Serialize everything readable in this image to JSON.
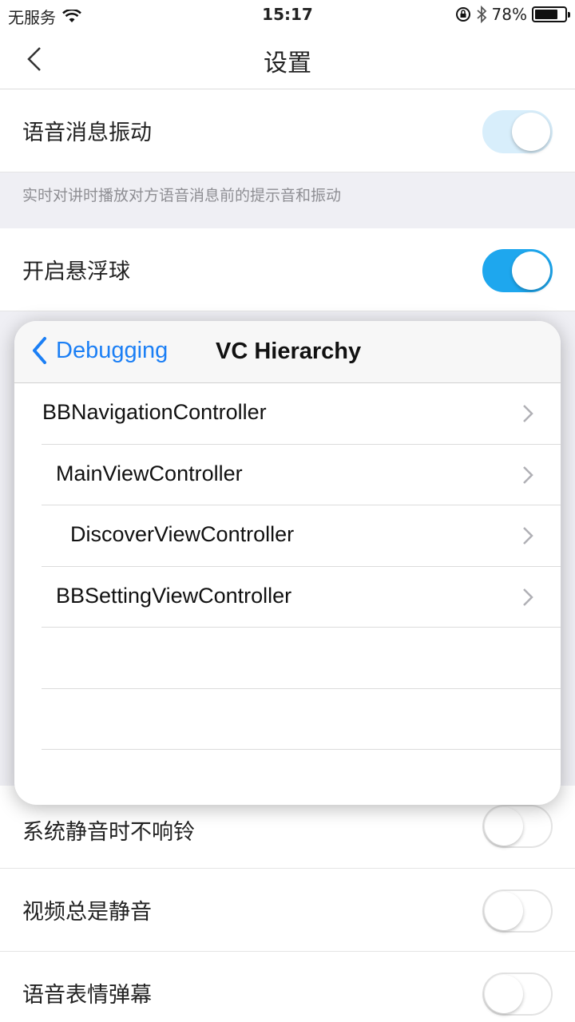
{
  "statusbar": {
    "carrier": "无服务",
    "time": "15:17",
    "battery": "78%",
    "battery_level": 0.78
  },
  "navbar": {
    "title": "设置",
    "back_icon": "chevron-left-icon"
  },
  "settings": {
    "voice_vibrate": {
      "label": "语音消息振动",
      "state": "on"
    },
    "voice_vibrate_desc": "实时对讲时播放对方语音消息前的提示音和振动",
    "float_ball": {
      "label": "开启悬浮球",
      "state": "on"
    },
    "silent_no_ring": {
      "label": "系统静音时不响铃",
      "state": "off"
    },
    "video_mute": {
      "label": "视频总是静音",
      "state": "off"
    },
    "voice_emoji": {
      "label": "语音表情弹幕",
      "state": "off"
    }
  },
  "debug_panel": {
    "back_label": "Debugging",
    "title": "VC Hierarchy",
    "accent": "#1b7ff5",
    "items": [
      {
        "label": "BBNavigationController",
        "indent": 0
      },
      {
        "label": "MainViewController",
        "indent": 1
      },
      {
        "label": "DiscoverViewController",
        "indent": 2
      },
      {
        "label": "BBSettingViewController",
        "indent": 1
      }
    ]
  },
  "colors": {
    "toggle_on": "#1ea7ee",
    "background": "#efeff4"
  }
}
